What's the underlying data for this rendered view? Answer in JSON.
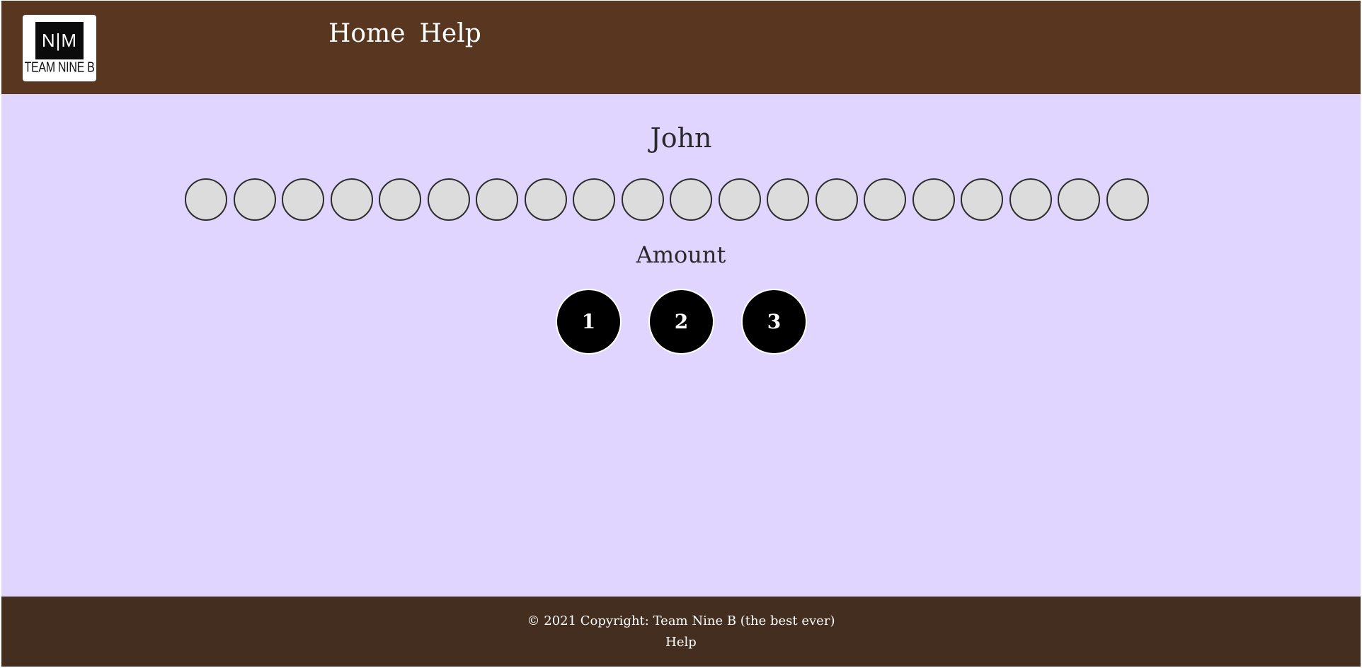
{
  "header": {
    "logo": {
      "mark": "N|M",
      "text": "TEAM NINE B"
    },
    "nav": [
      {
        "label": "Home"
      },
      {
        "label": "Help"
      }
    ]
  },
  "game": {
    "player_name": "John",
    "stones_remaining": 20,
    "amount_label": "Amount",
    "amount_options": [
      "1",
      "2",
      "3"
    ]
  },
  "footer": {
    "copyright": "© 2021 Copyright: Team Nine B (the best ever)",
    "help_link": "Help"
  },
  "colors": {
    "header_bg": "#58361f",
    "game_bg": "#e0d5ff",
    "footer_bg": "#432e1f",
    "stone_fill": "#dcdcdc",
    "amount_button_fill": "#000000"
  }
}
